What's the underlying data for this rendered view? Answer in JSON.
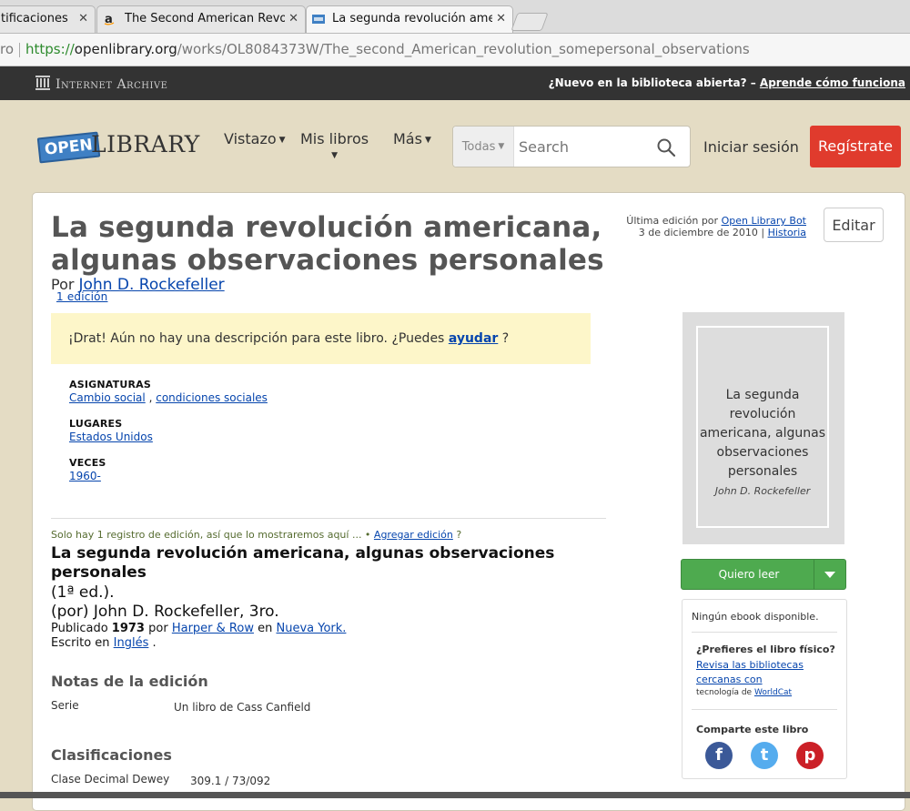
{
  "browser": {
    "tabs": [
      {
        "title": "tificaciones",
        "close": "✕"
      },
      {
        "title": "The Second American Revolut",
        "close": "✕"
      },
      {
        "title": "La segunda revolución americ",
        "close": "✕"
      }
    ],
    "address": {
      "prefix": "ro",
      "scheme": "https://",
      "domain": "openlibrary.org",
      "path": "/works/OL8084373W/The_second_American_revolution_somepersonal_observations"
    }
  },
  "ia_bar": {
    "logo": "Internet Archive",
    "prompt": "¿Nuevo en la biblioteca abierta? –",
    "link": "Aprende cómo funciona"
  },
  "header": {
    "logo_open": "OPEN",
    "logo_library": "LIBRARY",
    "nav": [
      {
        "label": "Vistazo"
      },
      {
        "label": "Mis libros"
      },
      {
        "label": "Más"
      }
    ],
    "search_scope": "Todas",
    "search_placeholder": "Search",
    "login": "Iniciar sesión",
    "register": "Regístrate"
  },
  "work": {
    "title": "La segunda revolución americana, algunas observaciones personales",
    "edition_count": "1 edición",
    "by_prefix": "Por",
    "author": "John D. Rockefeller",
    "last_edit_prefix": "Última edición por",
    "last_edit_user": "Open Library Bot",
    "last_edit_date": "3 de diciembre de 2010 |",
    "history": "Historia",
    "edit_button": "Editar",
    "description_prefix": "¡Drat! Aún no hay una descripción para este libro. ¿Puedes",
    "description_link": "ayudar",
    "description_suffix": "?",
    "subjects_heading": "ASIGNATURAS",
    "subject_1": "Cambio social",
    "subject_sep": ",",
    "subject_2": "condiciones sociales",
    "places_heading": "LUGARES",
    "place_1": "Estados Unidos",
    "times_heading": "VECES",
    "time_1": "1960-"
  },
  "edition": {
    "only_one": "Solo hay 1 registro de edición, así que lo mostraremos aquí ... •",
    "add_edition": "Agregar edición",
    "add_suffix": "?",
    "title": "La segunda revolución americana, algunas observaciones personales",
    "edition_number": "(1ª ed.).",
    "by_statement": "(por) John D. Rockefeller, 3ro.",
    "published_prefix": "Publicado",
    "year": "1973",
    "por": "por",
    "publisher": "Harper & Row",
    "en": "en",
    "place": "Nueva York.",
    "written_in": "Escrito en",
    "language": "Inglés",
    "period": ".",
    "notes_heading": "Notas de la edición",
    "series_label": "Serie",
    "series_value": "Un libro de Cass Canfield",
    "classifications_heading": "Clasificaciones",
    "dewey_label": "Clase Decimal Dewey",
    "dewey_value": "309.1 / 73/092"
  },
  "sidebar": {
    "cover_title": "La segunda revolución americana, algunas observaciones personales",
    "cover_author": "John D. Rockefeller",
    "want_to_read": "Quiero leer",
    "no_ebook": "Ningún ebook disponible.",
    "physical_prompt": "¿Prefieres el libro físico?",
    "libraries_link": "Revisa las bibliotecas cercanas con",
    "tech_prefix": "tecnología de",
    "worldcat": "WorldCat",
    "share_heading": "Comparte este libro",
    "share": {
      "facebook": "f",
      "twitter": "t",
      "pinterest": "p"
    }
  }
}
